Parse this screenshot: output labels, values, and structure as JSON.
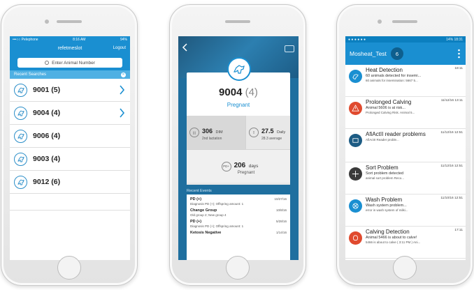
{
  "phone1": {
    "status": {
      "carrier": "•••○○ Pelephone",
      "time": "8:16 AM",
      "battery": "94%"
    },
    "title": "refetmeslot",
    "logout": "Logout",
    "search_placeholder": "Enter Animal Number",
    "recent_label": "Recent Searches",
    "rows": [
      {
        "label": "9001 (5)",
        "has_arrow": true
      },
      {
        "label": "9004 (4)",
        "has_arrow": true
      },
      {
        "label": "9006 (4)",
        "has_arrow": false
      },
      {
        "label": "9003 (4)",
        "has_arrow": false
      },
      {
        "label": "9012 (6)",
        "has_arrow": false
      }
    ]
  },
  "phone2": {
    "animal": "9004",
    "count": "(4)",
    "state": "Pregnant",
    "dim_value": "306",
    "dim_unit": "DIM",
    "dim_sub": "2nd lactation",
    "daily_value": "27.5",
    "daily_unit": "Daily",
    "daily_sub": "28.3 average",
    "pd_value": "206",
    "pd_unit": "days",
    "pd_sub": "Pregnant",
    "pd_icon_text": "PD+",
    "events_title": "Recent Events",
    "events": [
      {
        "title": "PD (+)",
        "date": "10/27/16",
        "sub": "Diagnosis PD (+); Offspring amount: 1"
      },
      {
        "title": "Change Group",
        "date": "10/8/16",
        "sub": "Old group 2; New group 4"
      },
      {
        "title": "PD (+)",
        "date": "5/28/16",
        "sub": "Diagnosis PD (+); Offspring amount: 1"
      },
      {
        "title": "Ketosis Negative",
        "date": "1/14/16",
        "sub": ""
      }
    ]
  },
  "phone3": {
    "status": {
      "icons": "● ● ● ● ● ●",
      "right": "14% 18:31"
    },
    "title": "Mosheat_Test",
    "count": "6",
    "items": [
      {
        "title": "Heat Detection",
        "time": "18:11",
        "line1": "60 animals detected for insemi...",
        "line2": "60 animals for insemination:  5667    5...",
        "color": "#1a8fd1"
      },
      {
        "title": "Prolonged Calving",
        "time": "11/12/16 13:11",
        "line1": "Animal 5606 is at risk...",
        "line2": "Prolonged Calving Risk.  Animal 5...",
        "color": "#e04a2e"
      },
      {
        "title": "AfiActII reader problems",
        "time": "11/12/16 12:51",
        "line1": "",
        "line2": "AfiActII Reader proble...",
        "color": "#1d5c84"
      },
      {
        "title": "Sort Problem",
        "time": "11/12/16 12:51",
        "line1": "Sort problem detected",
        "line2": "animal sort problem    Reco...",
        "color": "#3a3a3a"
      },
      {
        "title": "Wash Problem",
        "time": "11/10/16 12:51",
        "line1": "Wash system problem...",
        "line2": "error in wash system of milki...",
        "color": "#1a8fd1"
      },
      {
        "title": "Calving Detection",
        "time": "17:11",
        "line1": "Animal 5466 is about to calve!",
        "line2": "5466 is about to calve ( 3:11 PM )   Ani...",
        "color": "#e04a2e"
      }
    ]
  }
}
